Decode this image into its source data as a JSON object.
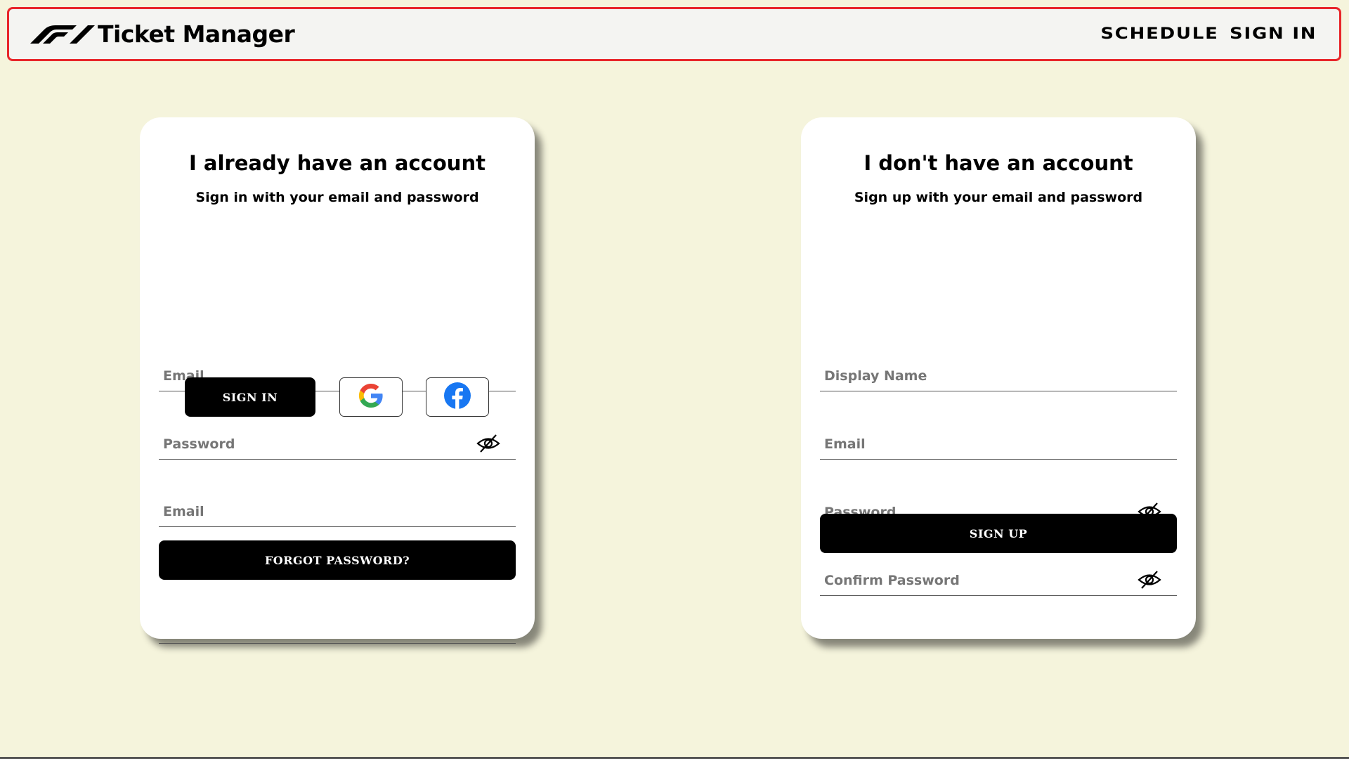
{
  "header": {
    "brand_mark": "F1",
    "title": "Ticket Manager",
    "nav": [
      {
        "label": "SCHEDULE"
      },
      {
        "label": "SIGN IN"
      }
    ],
    "border_color": "#e8262a"
  },
  "signin_card": {
    "title": "I already have an account",
    "subtitle": "Sign in with your email and password",
    "email_placeholder": "Email",
    "password_placeholder": "Password",
    "password_toggle_icon": "eye-slash-icon",
    "signin_button": "SIGN IN",
    "google_icon": "google-icon",
    "facebook_icon": "facebook-icon",
    "reset_email_placeholder": "Email",
    "forgot_button": "FORGOT PASSWORD?"
  },
  "signup_card": {
    "title": "I don't have an account",
    "subtitle": "Sign up with your email and password",
    "display_name_placeholder": "Display Name",
    "email_placeholder": "Email",
    "password_placeholder": "Password",
    "confirm_password_placeholder": "Confirm Password",
    "password_toggle_icon": "eye-slash-icon",
    "signup_button": "SIGN UP"
  },
  "colors": {
    "page_background": "#f5f4dc",
    "card_background": "#ffffff",
    "button_background": "#000000",
    "facebook_blue": "#1877f2"
  }
}
